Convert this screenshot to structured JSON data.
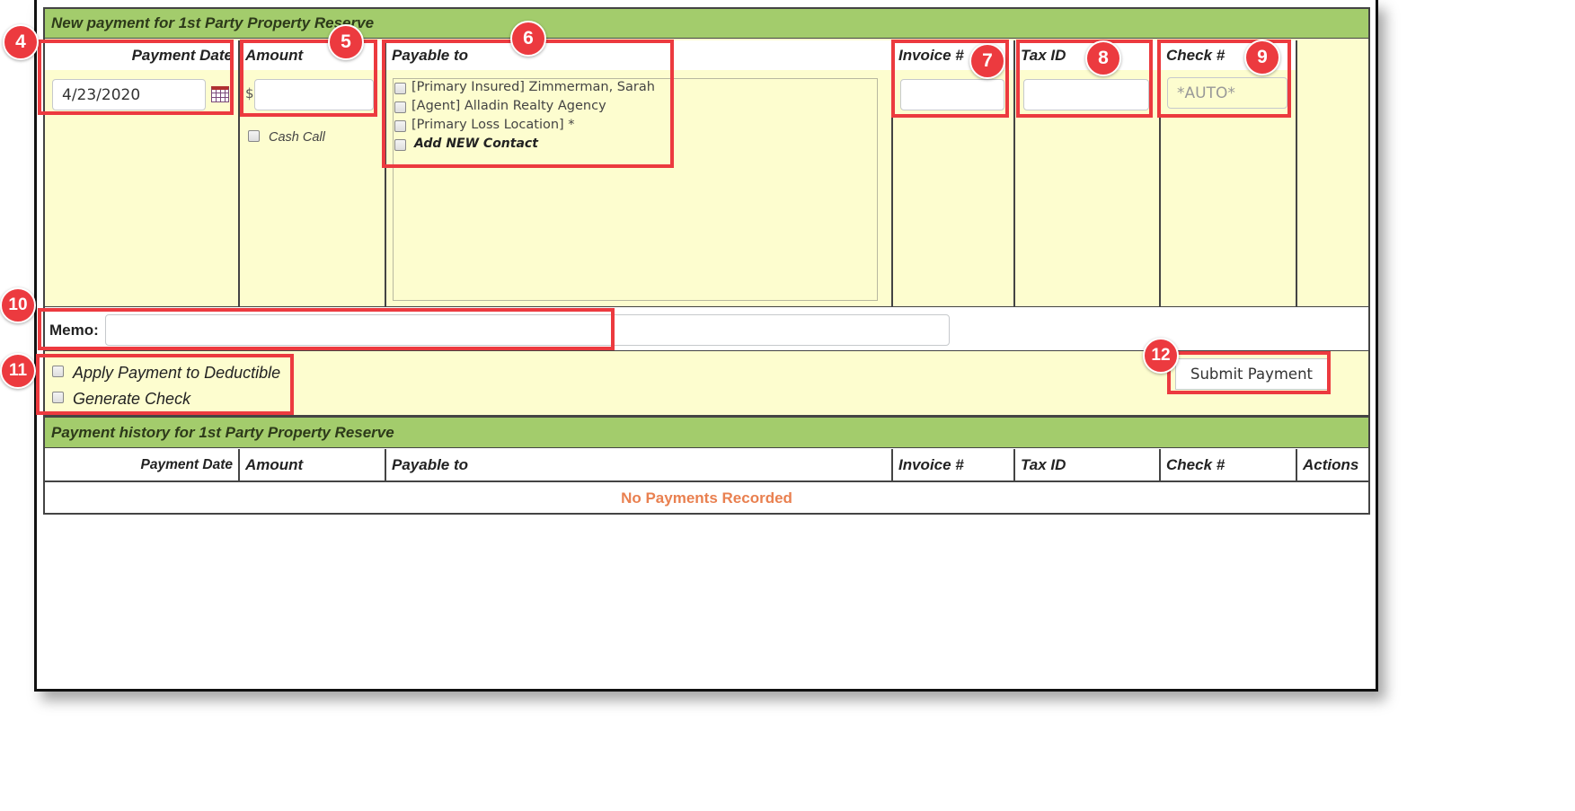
{
  "new_payment": {
    "title": "New payment for 1st Party Property Reserve",
    "headers": {
      "payment_date": "Payment Date",
      "amount": "Amount",
      "payable_to": "Payable to",
      "invoice": "Invoice #",
      "tax_id": "Tax ID",
      "check": "Check #"
    },
    "payment_date_value": "4/23/2020",
    "currency_symbol": "$",
    "amount_value": "",
    "cash_call_label": "Cash Call",
    "payees": [
      "[Primary Insured] Zimmerman, Sarah",
      "[Agent] Alladin Realty Agency",
      "[Primary Loss Location] *",
      "Add NEW Contact"
    ],
    "invoice_value": "",
    "tax_id_value": "",
    "check_placeholder": "*AUTO*",
    "memo_label": "Memo:",
    "memo_value": "",
    "apply_deductible_label": "Apply Payment to Deductible",
    "generate_check_label": "Generate Check",
    "submit_label": "Submit Payment"
  },
  "history": {
    "title": "Payment history for 1st Party Property Reserve",
    "headers": {
      "payment_date": "Payment Date",
      "amount": "Amount",
      "payable_to": "Payable to",
      "invoice": "Invoice #",
      "tax_id": "Tax ID",
      "check": "Check #",
      "actions": "Actions"
    },
    "empty_message": "No Payments Recorded"
  },
  "callouts": [
    "4",
    "5",
    "6",
    "7",
    "8",
    "9",
    "10",
    "11",
    "12"
  ],
  "colors": {
    "header_green": "#a3cc6c",
    "cell_yellow": "#fdfdcf",
    "callout_red": "#ec3a3f",
    "empty_message_orange": "#e98050"
  }
}
